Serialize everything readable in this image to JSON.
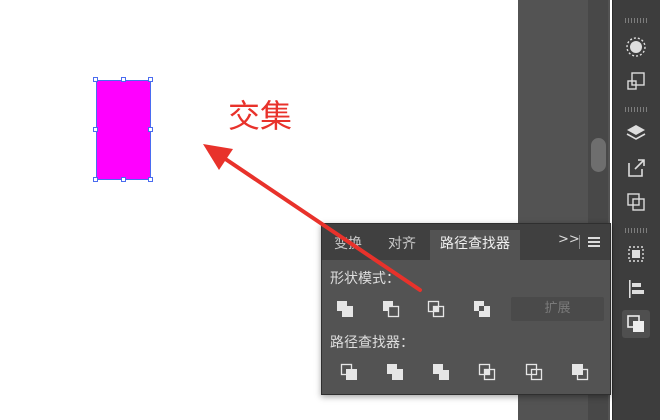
{
  "canvas": {
    "annotation_text": "交集",
    "shape_fill": "#ff00ff",
    "arrow_color": "#e8322b"
  },
  "panel": {
    "tabs": [
      {
        "label": "变换",
        "active": false
      },
      {
        "label": "对齐",
        "active": false
      },
      {
        "label": "路径查找器",
        "active": true
      }
    ],
    "overflow_label": ">>",
    "menu_icon": "hamburger-menu-icon",
    "shape_modes_label": "形状模式：",
    "shape_mode_buttons": [
      "unite-icon",
      "minus-front-icon",
      "intersect-icon",
      "exclude-icon"
    ],
    "expand_label": "扩展",
    "pathfinders_label": "路径查找器：",
    "pathfinder_buttons": [
      "divide-icon",
      "trim-icon",
      "merge-icon",
      "crop-icon",
      "outline-icon",
      "minus-back-icon"
    ]
  },
  "toolbar": {
    "icons": [
      "appearance-icon",
      "artboard-icon",
      "layers-icon",
      "export-icon",
      "transform-icon",
      "align-distribute-icon",
      "align-icon",
      "pathfinder-icon"
    ],
    "active": "pathfinder-icon"
  }
}
